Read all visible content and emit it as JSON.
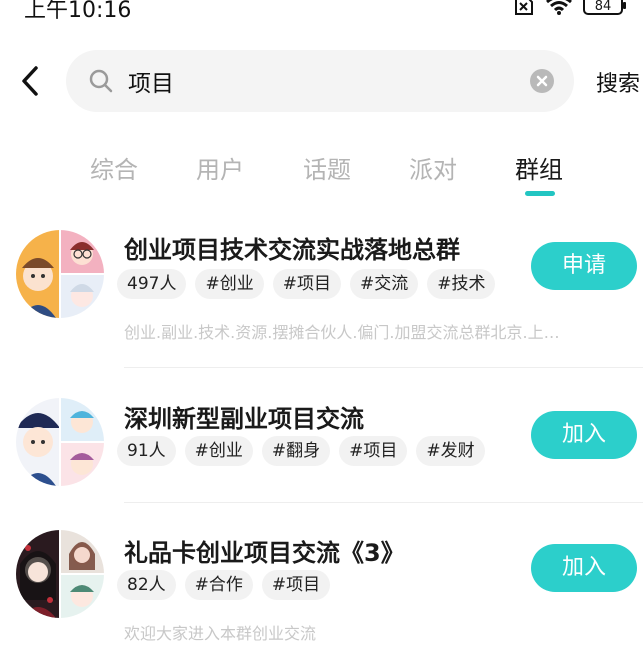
{
  "status_bar": {
    "time": "上午10:16",
    "battery": "84"
  },
  "search": {
    "query": "项目",
    "placeholder": "",
    "submit_label": "搜索"
  },
  "tabs": [
    {
      "label": "综合"
    },
    {
      "label": "用户"
    },
    {
      "label": "话题"
    },
    {
      "label": "派对"
    },
    {
      "label": "群组",
      "active": true
    }
  ],
  "groups": [
    {
      "title": "创业项目技术交流实战落地总群",
      "tags": [
        "497人",
        "#创业",
        "#项目",
        "#交流",
        "#技术"
      ],
      "description": "创业.副业.技术.资源.摆摊合伙人.偏门.加盟交流总群北京.上…",
      "action": "申请"
    },
    {
      "title": "深圳新型副业项目交流",
      "tags": [
        "91人",
        "#创业",
        "#翻身",
        "#项目",
        "#发财"
      ],
      "description": "",
      "action": "加入"
    },
    {
      "title": "礼品卡创业项目交流《3》",
      "tags": [
        "82人",
        "#合作",
        "#项目"
      ],
      "description": "欢迎大家进入本群创业交流",
      "action": "加入"
    }
  ],
  "colors": {
    "accent": "#2ccfcb",
    "tab_indicator": "#22c5c2"
  }
}
